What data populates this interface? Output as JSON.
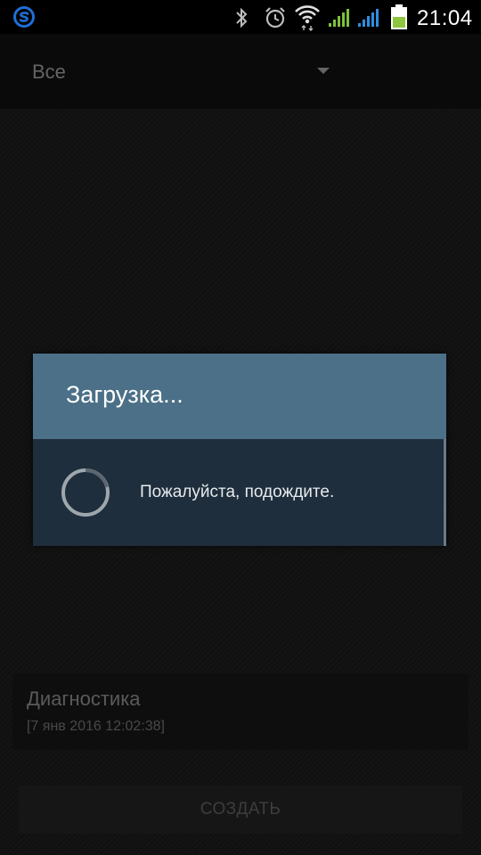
{
  "status_bar": {
    "time": "21:04",
    "icons": [
      "app-s-icon",
      "bluetooth-icon",
      "alarm-icon",
      "wifi-icon",
      "signal-icon",
      "signal-icon-2",
      "battery-icon"
    ],
    "accent_color": "#1f6fd6",
    "signal_green": "#7dc23b",
    "signal_blue": "#2f8fe0",
    "battery_color": "#8dc63f"
  },
  "filter": {
    "selected": "Все"
  },
  "list": {
    "items": [
      {
        "title": "Диагностика",
        "date": "[7 янв 2016 12:02:38]"
      }
    ]
  },
  "actions": {
    "create_label": "СОЗДАТЬ"
  },
  "dialog": {
    "title": "Загрузка...",
    "message": "Пожалуйста, подождите.",
    "header_color": "#4b7087",
    "body_color": "#1f2e3c"
  }
}
